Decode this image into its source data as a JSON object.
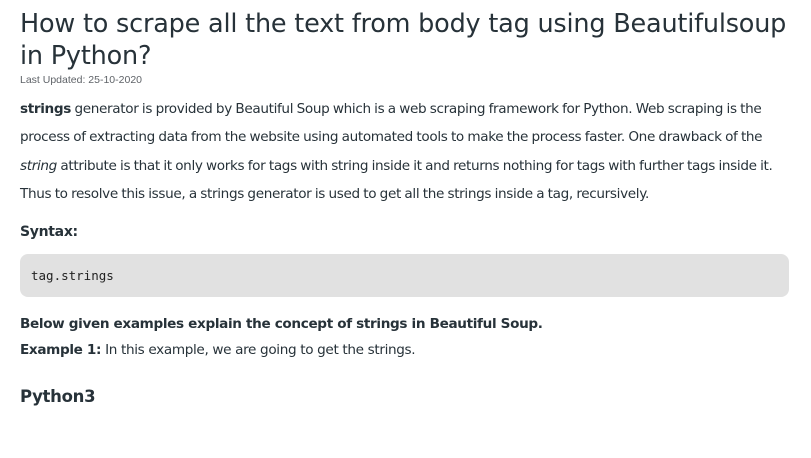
{
  "article": {
    "title": "How to scrape all the text from body tag using Beautifulsoup in Python?",
    "last_updated": "Last Updated: 25-10-2020",
    "intro": {
      "strong": "strings",
      "part1": " generator is provided by Beautiful Soup which is a web scraping framework for Python. Web scraping is the process of extracting data from the website using automated tools to make the process faster. One drawback of the ",
      "italic": "string",
      "part2": " attribute is that it only works for tags with string inside it and returns nothing for tags with further tags inside it. Thus to resolve this issue, a strings generator is used to get all the strings inside a tag, recursively."
    },
    "syntax_heading": "Syntax:",
    "syntax_code": "tag.strings",
    "examples_intro": "Below given examples explain the concept of strings in Beautiful Soup.",
    "example1": {
      "label": "Example 1:",
      "text": " In this example, we are going to get the strings."
    },
    "code_language": "Python3"
  }
}
